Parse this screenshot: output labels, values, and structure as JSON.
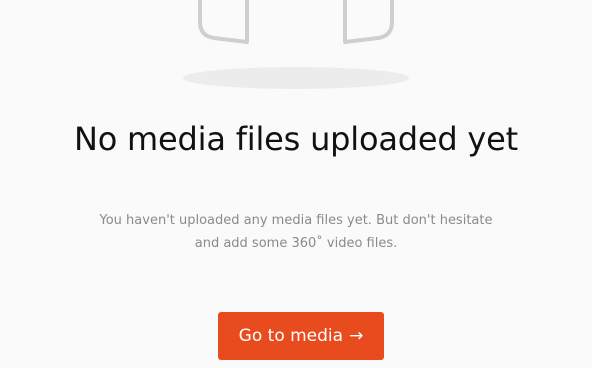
{
  "empty_state": {
    "illustration_icon": "empty-box-icon",
    "title": "No media files uploaded yet",
    "description": "You haven't uploaded any media files yet. But don't hesitate and add some 360˚ video files.",
    "button_label": "Go to media",
    "button_arrow": "→",
    "button_arrow_icon": "arrow-right-icon",
    "accent_color": "#e84c1e",
    "illustration_color": "#cfcfcf",
    "shadow_color": "#ececec"
  }
}
